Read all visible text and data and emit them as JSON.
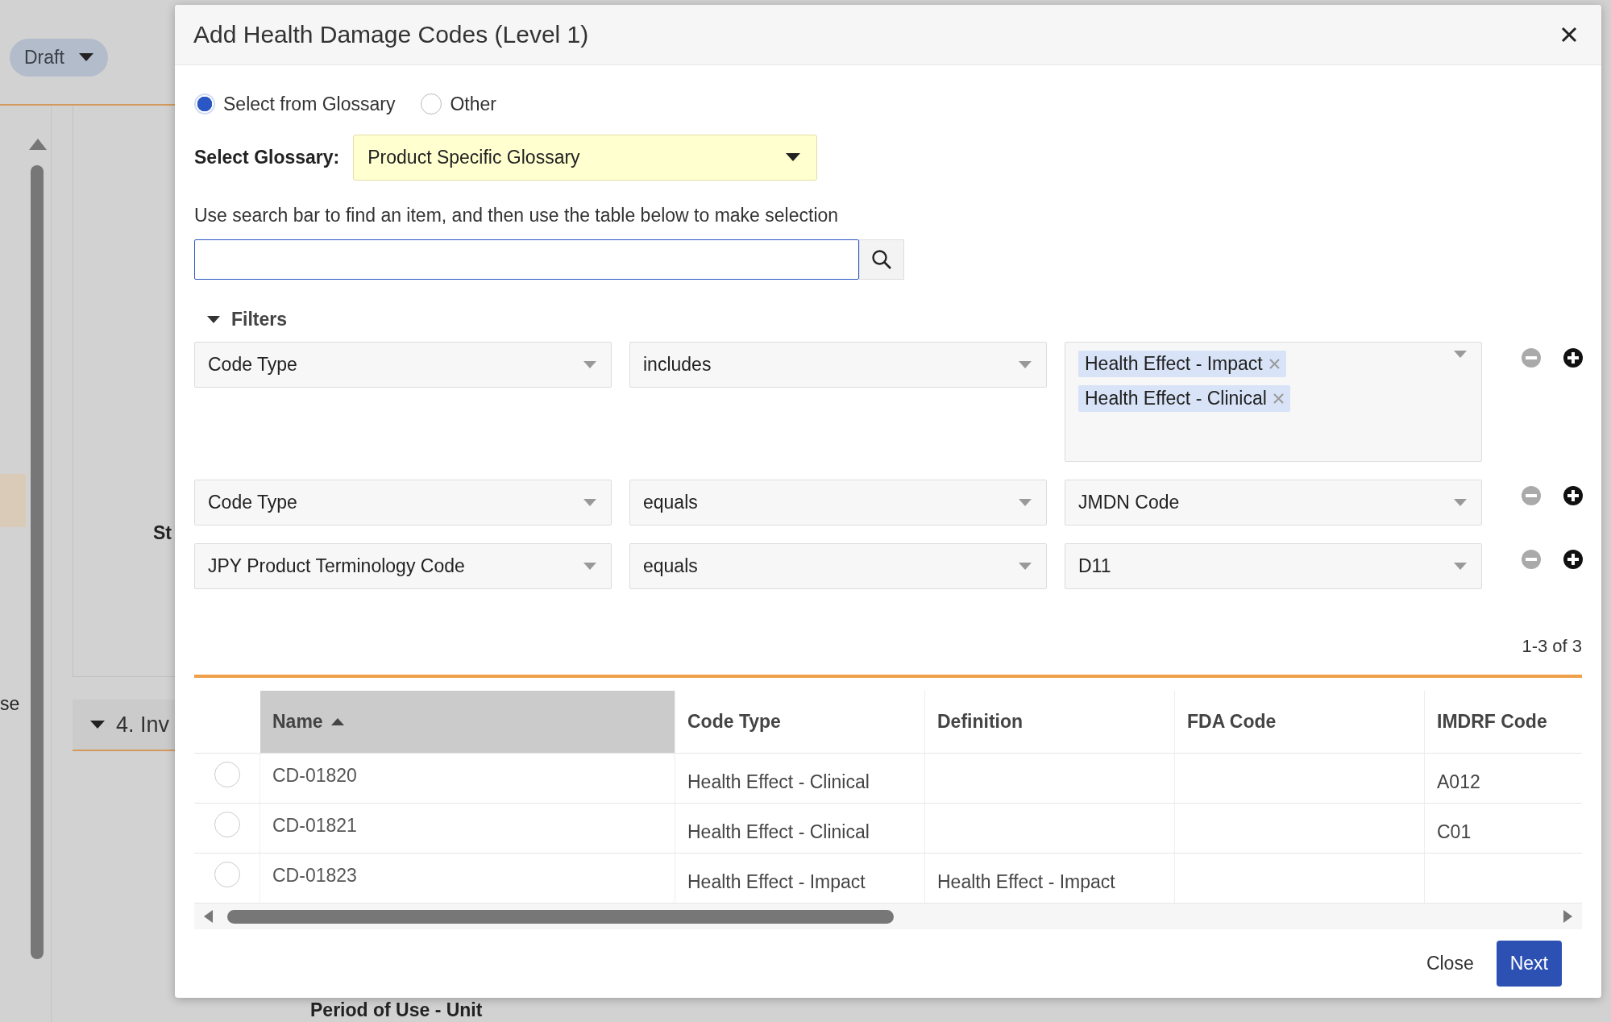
{
  "background": {
    "status_button": "Draft",
    "fragments": [
      {
        "kind": "label",
        "text": "St"
      },
      {
        "kind": "text",
        "text": "se"
      }
    ],
    "section": {
      "title": "4. Inv",
      "expanded": true
    },
    "bottom_label": "Period of Use - Unit"
  },
  "dialog": {
    "title": "Add Health Damage Codes (Level 1)",
    "source_options": [
      {
        "label": "Select from Glossary",
        "selected": true
      },
      {
        "label": "Other",
        "selected": false
      }
    ],
    "glossary": {
      "label": "Select Glossary:",
      "value": "Product Specific Glossary"
    },
    "hint": "Use search bar to find an item, and then use the table below to make selection",
    "filters": {
      "label": "Filters",
      "expanded": true,
      "rows": [
        {
          "field": "Code Type",
          "operator": "includes",
          "kind": "tags",
          "values": [
            "Health Effect - Impact",
            "Health Effect - Clinical"
          ]
        },
        {
          "field": "Code Type",
          "operator": "equals",
          "kind": "select",
          "values": [
            "JMDN Code"
          ]
        },
        {
          "field": "JPY Product Terminology Code",
          "operator": "equals",
          "kind": "select",
          "values": [
            "D11"
          ]
        }
      ]
    },
    "count": "1-3 of 3",
    "table": {
      "columns": [
        {
          "label": "Name",
          "sorted": true
        },
        {
          "label": "Code Type",
          "sorted": false
        },
        {
          "label": "Definition",
          "sorted": false
        },
        {
          "label": "FDA Code",
          "sorted": false
        },
        {
          "label": "IMDRF Code",
          "sorted": false
        }
      ],
      "rows": [
        {
          "selected": false,
          "cells": [
            "CD-01820",
            "Health Effect - Clinical",
            "",
            "",
            "A012"
          ]
        },
        {
          "selected": false,
          "cells": [
            "CD-01821",
            "Health Effect - Clinical",
            "",
            "",
            "C01"
          ]
        },
        {
          "selected": false,
          "cells": [
            "CD-01823",
            "Health Effect - Impact",
            "Health Effect - Impact",
            "",
            ""
          ]
        }
      ]
    },
    "buttons": [
      {
        "label": "Close",
        "kind": "link"
      },
      {
        "label": "Next",
        "kind": "primary"
      }
    ]
  }
}
